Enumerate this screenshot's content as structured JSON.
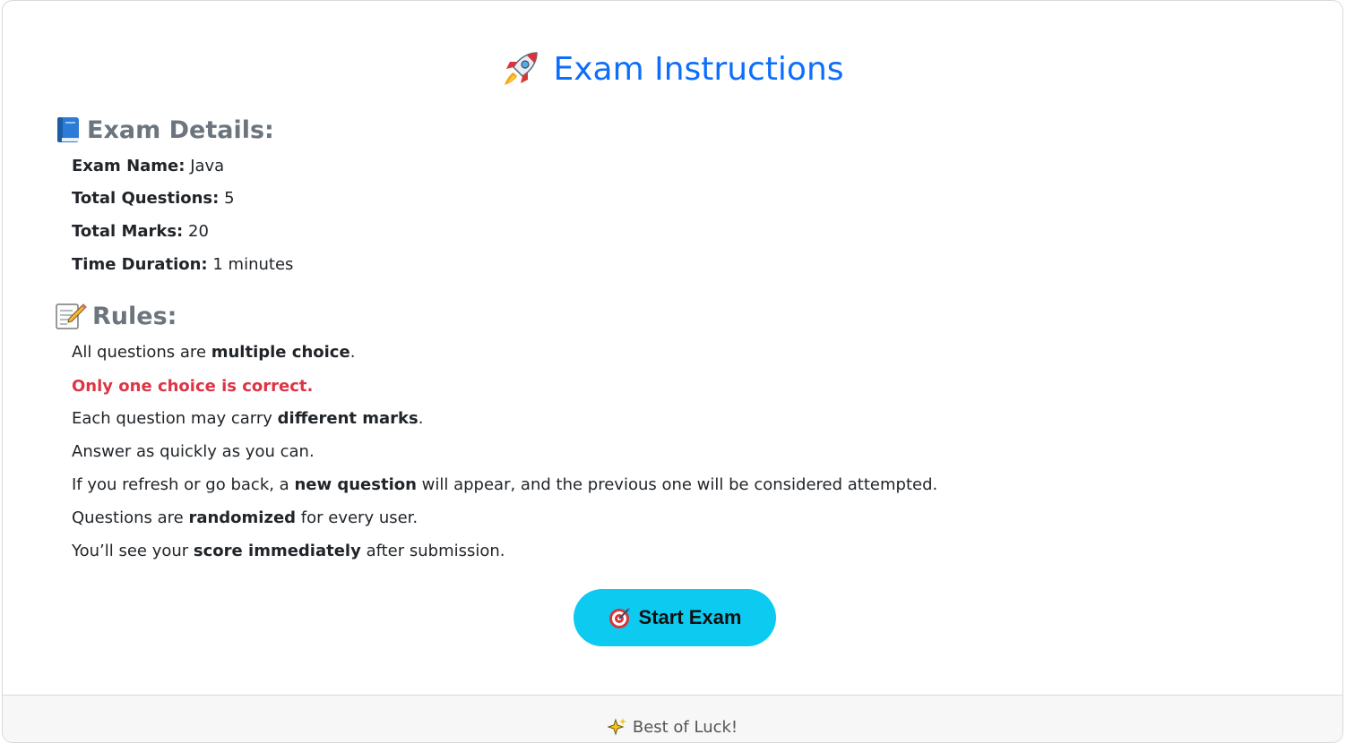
{
  "header": {
    "title": "Exam Instructions",
    "icon": "rocket-icon"
  },
  "details": {
    "heading": "Exam Details:",
    "icon": "book-icon",
    "exam_name_label": "Exam Name:",
    "exam_name_value": "Java",
    "total_questions_label": "Total Questions:",
    "total_questions_value": "5",
    "total_marks_label": "Total Marks:",
    "total_marks_value": "20",
    "time_duration_label": "Time Duration:",
    "time_duration_value": "1 minutes"
  },
  "rules": {
    "heading": "Rules:",
    "icon": "memo-icon",
    "r1_pre": "All questions are ",
    "r1_bold": "multiple choice",
    "r1_post": ".",
    "r2": "Only one choice is correct.",
    "r3_pre": "Each question may carry ",
    "r3_bold": "different marks",
    "r3_post": ".",
    "r4": "Answer as quickly as you can.",
    "r5_pre": "If you refresh or go back, a ",
    "r5_bold": "new question",
    "r5_post": " will appear, and the previous one will be considered attempted.",
    "r6_pre": "Questions are ",
    "r6_bold": "randomized",
    "r6_post": " for every user.",
    "r7_pre": "You’ll see your ",
    "r7_bold": "score immediately",
    "r7_post": " after submission."
  },
  "start_button": {
    "label": "Start Exam",
    "icon": "target-icon"
  },
  "footer": {
    "text": "Best of Luck!",
    "icon": "sparkles-icon"
  },
  "colors": {
    "title": "#0d6efd",
    "heading": "#6c757d",
    "warning": "#dc3545",
    "button": "#0dcaf0"
  }
}
